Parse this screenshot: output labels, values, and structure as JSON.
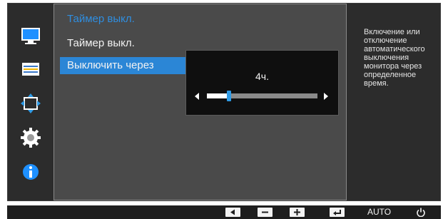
{
  "menu": {
    "title": "Таймер выкл.",
    "items": [
      {
        "label": "Таймер выкл.",
        "selected": false
      },
      {
        "label": "Выключить через",
        "selected": true
      }
    ]
  },
  "popup": {
    "value": "4ч.",
    "slider_fraction": 0.2
  },
  "help": {
    "lines": [
      "Включение или",
      "отключение",
      "автоматического",
      "выключения",
      "монитора через",
      "определенное",
      "время."
    ]
  },
  "bottom": {
    "auto_label": "AUTO"
  },
  "icons": [
    "picture-icon",
    "onscreen-display-icon",
    "position-icon",
    "gear-icon",
    "info-icon"
  ],
  "colors": {
    "accent": "#2b86d6",
    "title": "#2f8ee0",
    "background": "#2c2c2c",
    "panel": "#4a4a4a"
  }
}
